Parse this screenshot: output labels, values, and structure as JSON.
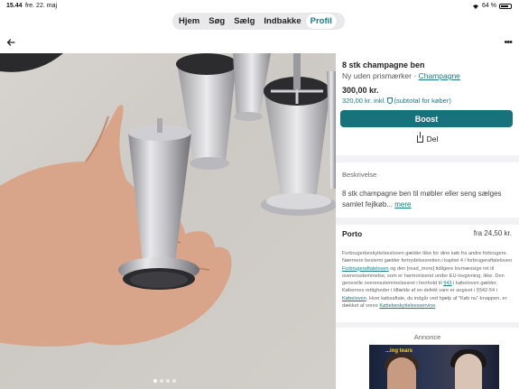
{
  "status": {
    "time": "15.44",
    "date": "fre. 22. maj",
    "battery": "64 %"
  },
  "tabs": [
    {
      "label": "Hjem"
    },
    {
      "label": "Søg"
    },
    {
      "label": "Sælg"
    },
    {
      "label": "Indbakke"
    },
    {
      "label": "Profil"
    }
  ],
  "nav": {
    "more": "•••"
  },
  "listing": {
    "title": "8 stk champagne ben",
    "condition": "Ny uden prismærker",
    "separator": "·",
    "color": "Champagne",
    "price": "300,00 kr.",
    "buyer_price": "320,00 kr. inkl.",
    "buyer_note": "(subtotal for køber)",
    "boost_label": "Boost",
    "share_label": "Del"
  },
  "description": {
    "label": "Beskrivelse",
    "text": "8 stk champagne ben til møbler eller seng sælges samlet fejlkøb...",
    "more": "mere"
  },
  "shipping": {
    "label": "Porto",
    "price": "fra 24,50 kr."
  },
  "legal": {
    "p1": "Forbrugerbeskyttelsesloven gælder ikke for dine køb fra andre forbrugere. Nærmere bestemt gælder fortrydelsesretten i kapitel 4 i forbrugeraftaleloven",
    "link1": "Forbrugeraftaleloven",
    "p2": "og den [read_more] tidligere lovmæssige ret til overensstemmelse, som er harmoniseret under EU-lovgivning, ikke. Den generelle overensstemmelsesret i henhold til",
    "link2": "§43",
    "p3": "i købeloven gælder. Købernes rettigheder i tilfælde af en defekt vare er angivet i §§42-54 i",
    "link3": "Købeloven",
    "p4": ". Hver købsaftale, du indgår ved hjælp af \"Køb nu\"-knappen, er dækket af vores",
    "link4": "Købebeskyttelsesservice",
    "p5": "."
  },
  "ad": {
    "label": "Annonce",
    "caption": "...ing tears"
  },
  "colors": {
    "accent": "#17727c",
    "link": "#1b7a84"
  }
}
